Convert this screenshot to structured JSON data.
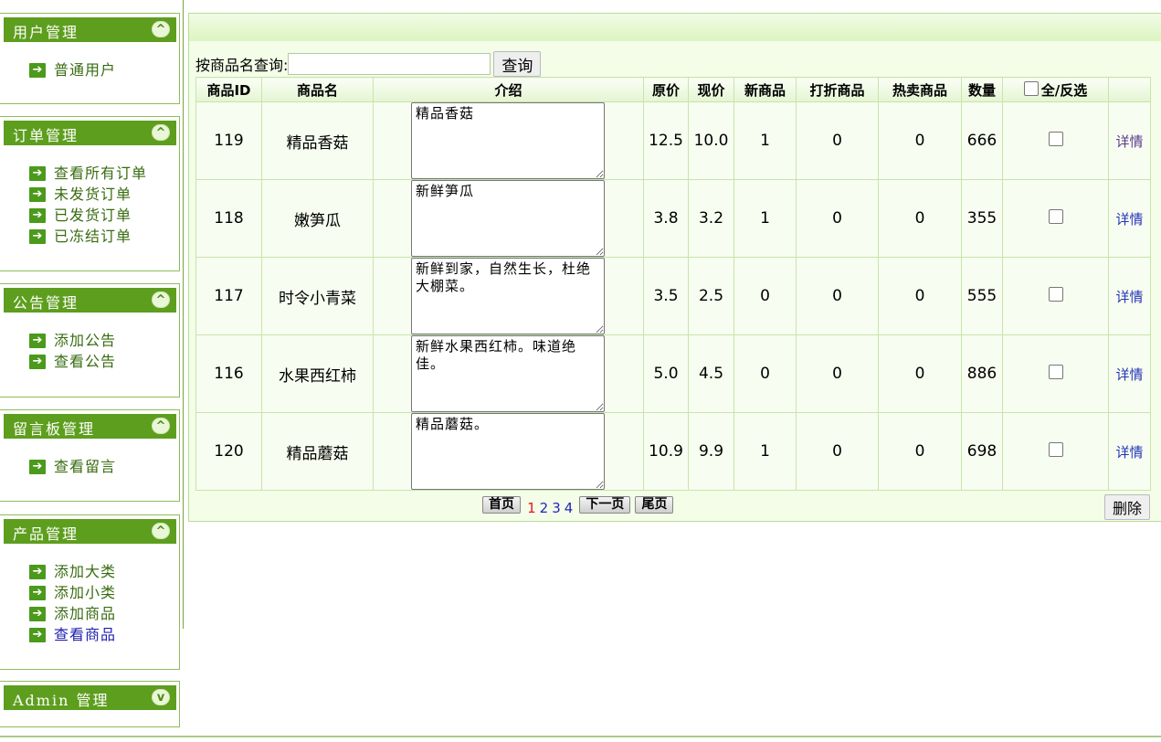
{
  "sidebar": {
    "sections": [
      {
        "title": "用户管理",
        "toggle": "^",
        "items": [
          {
            "label": "普通用户"
          }
        ]
      },
      {
        "title": "订单管理",
        "toggle": "^",
        "items": [
          {
            "label": "查看所有订单"
          },
          {
            "label": "未发货订单"
          },
          {
            "label": "已发货订单"
          },
          {
            "label": "已冻结订单"
          }
        ]
      },
      {
        "title": "公告管理",
        "toggle": "^",
        "items": [
          {
            "label": "添加公告"
          },
          {
            "label": "查看公告"
          }
        ]
      },
      {
        "title": "留言板管理",
        "toggle": "^",
        "items": [
          {
            "label": "查看留言"
          }
        ]
      },
      {
        "title": "产品管理",
        "toggle": "^",
        "items": [
          {
            "label": "添加大类"
          },
          {
            "label": "添加小类"
          },
          {
            "label": "添加商品"
          },
          {
            "label": "查看商品",
            "active": true
          }
        ]
      },
      {
        "title": "Admin 管理",
        "toggle": "v",
        "items": []
      }
    ]
  },
  "search": {
    "label": "按商品名查询:",
    "value": "",
    "button": "查询"
  },
  "table": {
    "headers": [
      "商品ID",
      "商品名",
      "介绍",
      "原价",
      "现价",
      "新商品",
      "打折商品",
      "热卖商品",
      "数量",
      "全/反选",
      ""
    ],
    "rows": [
      {
        "id": "119",
        "name": "精品香菇",
        "desc": "精品香菇",
        "orig": "12.5",
        "price": "10.0",
        "is_new": "1",
        "discount": "0",
        "hot": "0",
        "qty": "666",
        "action": "详情",
        "visited": true
      },
      {
        "id": "118",
        "name": "嫩笋瓜",
        "desc": "新鲜笋瓜",
        "orig": "3.8",
        "price": "3.2",
        "is_new": "1",
        "discount": "0",
        "hot": "0",
        "qty": "355",
        "action": "详情",
        "visited": false
      },
      {
        "id": "117",
        "name": "时令小青菜",
        "desc": "新鲜到家，自然生长，杜绝大棚菜。",
        "orig": "3.5",
        "price": "2.5",
        "is_new": "0",
        "discount": "0",
        "hot": "0",
        "qty": "555",
        "action": "详情",
        "visited": false
      },
      {
        "id": "116",
        "name": "水果西红柿",
        "desc": "新鲜水果西红柿。味道绝佳。",
        "orig": "5.0",
        "price": "4.5",
        "is_new": "0",
        "discount": "0",
        "hot": "0",
        "qty": "886",
        "action": "详情",
        "visited": false
      },
      {
        "id": "120",
        "name": "精品蘑菇",
        "desc": "精品蘑菇。",
        "orig": "10.9",
        "price": "9.9",
        "is_new": "1",
        "discount": "0",
        "hot": "0",
        "qty": "698",
        "action": "详情",
        "visited": false
      }
    ]
  },
  "pager": {
    "first": "首页",
    "pages": [
      "1",
      "2",
      "3",
      "4"
    ],
    "current": "1",
    "next": "下一页",
    "last": "尾页"
  },
  "delete_button": "删除",
  "colors": {
    "sidebar_header": "#5e9e1e",
    "link_green": "#386c10",
    "link_blue": "#2434b8",
    "current_page": "#e01818",
    "main_bg": "#f3fde8"
  }
}
